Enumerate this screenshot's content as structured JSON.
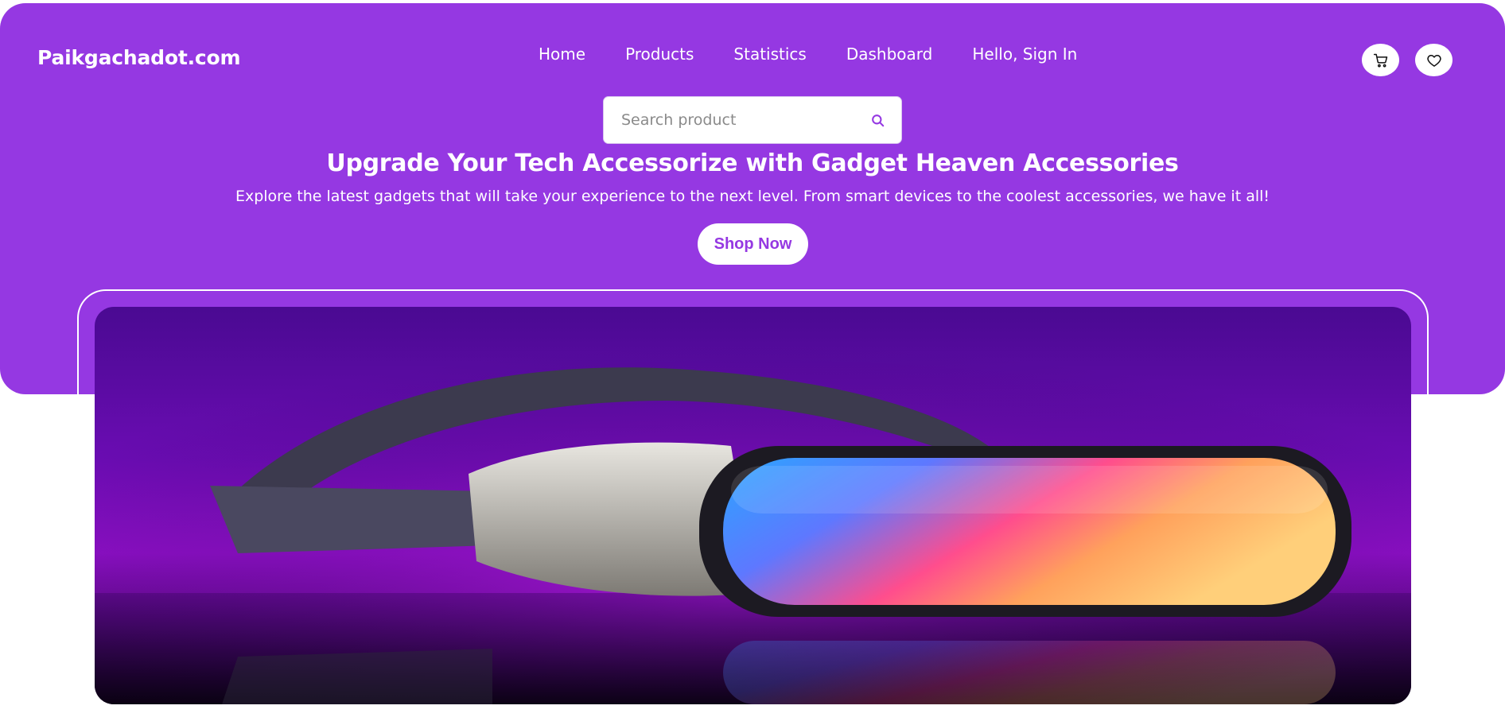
{
  "brand": {
    "logo_text": "Paikgachadot.com"
  },
  "nav": {
    "items": [
      {
        "label": "Home"
      },
      {
        "label": "Products"
      },
      {
        "label": "Statistics"
      },
      {
        "label": "Dashboard"
      },
      {
        "label": "Hello, Sign In"
      }
    ]
  },
  "header_icons": {
    "cart_icon": "shopping-cart-icon",
    "wishlist_icon": "heart-icon"
  },
  "search": {
    "placeholder": "Search product",
    "value": "",
    "icon": "search-icon"
  },
  "hero": {
    "headline": "Upgrade Your Tech Accessorize with Gadget Heaven Accessories",
    "subline": "Explore the latest gadgets that will take your experience to the next level. From smart devices to the coolest accessories, we have it all!",
    "cta_label": "Shop Now"
  },
  "colors": {
    "brand_purple": "#9538e2",
    "white": "#ffffff"
  }
}
